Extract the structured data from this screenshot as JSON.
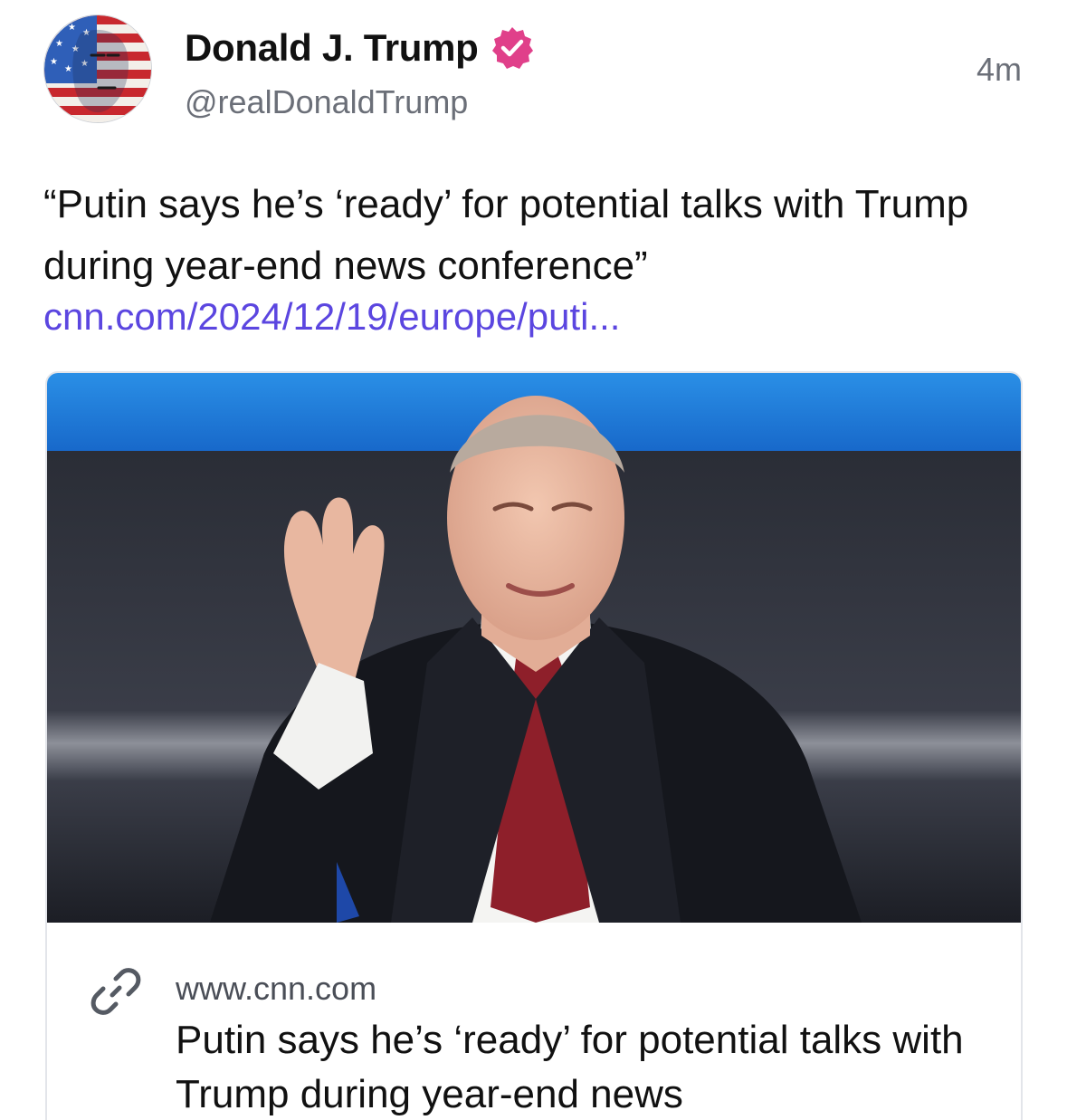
{
  "author": {
    "display_name": "Donald J. Trump",
    "handle": "@realDonaldTrump",
    "verified": true,
    "avatar_icon": "flag-face-avatar"
  },
  "post": {
    "timestamp": "4m",
    "text": "“Putin says he’s ‘ready’ for potential talks with Trump during year-end news conference”",
    "link_text": "cnn.com/2024/12/19/europe/puti..."
  },
  "card": {
    "domain": "www.cnn.com",
    "title": "Putin says he’s ‘ready’ for potential talks with Trump during year-end news",
    "link_icon": "link-icon"
  },
  "colors": {
    "link": "#5b46e0",
    "verified_badge": "#e0408a",
    "secondary_text": "#6b6f78"
  }
}
